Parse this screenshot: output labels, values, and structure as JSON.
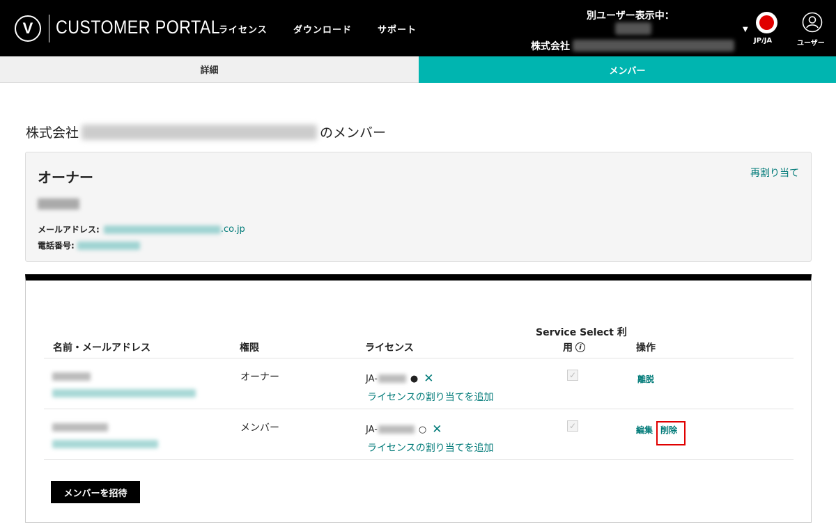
{
  "header": {
    "logo_letter": "V",
    "title": "CUSTOMER PORTAL",
    "nav": [
      "ライセンス",
      "ダウンロード",
      "サポート"
    ],
    "viewing_label": "別ユーザー表示中：",
    "viewing_company_prefix": "株式会社",
    "lang_label": "JP/JA",
    "user_label": "ユーザー"
  },
  "tabs": {
    "detail": "詳細",
    "members": "メンバー"
  },
  "page": {
    "heading_prefix": "株式会社",
    "heading_suffix": "のメンバー"
  },
  "owner_card": {
    "title": "オーナー",
    "reassign": "再割り当て",
    "email_label": "メールアドレス:",
    "email_suffix": ".co.jp",
    "phone_label": "電話番号:"
  },
  "members_table": {
    "headers": {
      "name": "名前・メールアドレス",
      "role": "権限",
      "license": "ライセンス",
      "service_select_line1": "Service Select 利",
      "service_select_line2": "用",
      "actions": "操作"
    },
    "rows": [
      {
        "role": "オーナー",
        "license_prefix": "JA-",
        "license_status": "●",
        "remove_license": "✕",
        "add_license": "ライセンスの割り当てを追加",
        "service_select_checked": true,
        "actions": [
          "離脱"
        ]
      },
      {
        "role": "メンバー",
        "license_prefix": "JA-",
        "license_status": "○",
        "remove_license": "✕",
        "add_license": "ライセンスの割り当てを追加",
        "service_select_checked": true,
        "actions": [
          "編集",
          "削除"
        ]
      }
    ],
    "invite_button": "メンバーを招待"
  },
  "colors": {
    "accent": "#00b5b0",
    "link": "#007a78",
    "highlight": "#e00000"
  }
}
